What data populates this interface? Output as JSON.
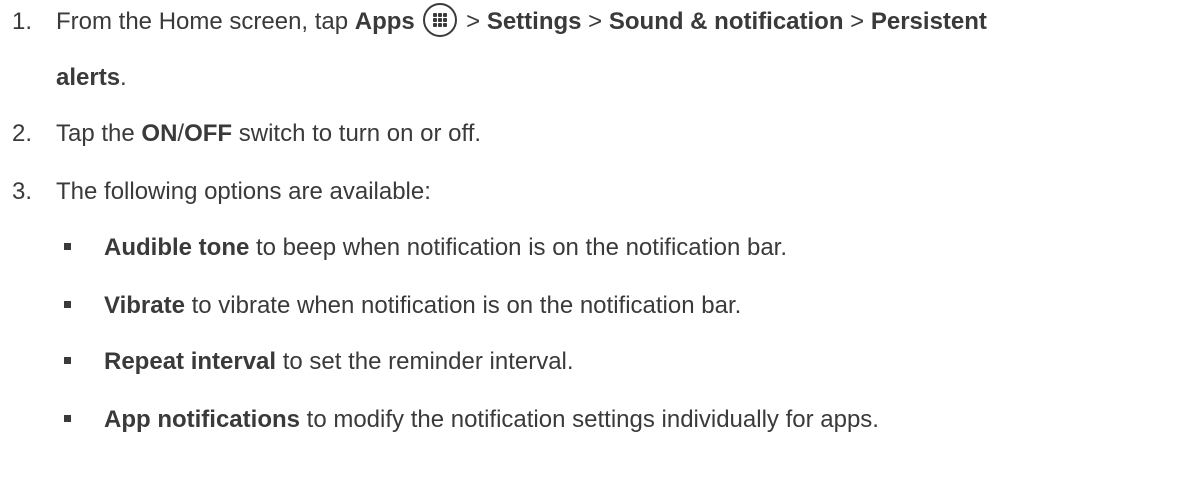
{
  "steps": [
    {
      "number": "1.",
      "text_before": "From the Home screen, tap ",
      "apps": "Apps",
      "sep1": " > ",
      "settings": "Settings",
      "sep2": " > ",
      "sound": "Sound & notification",
      "sep3": " > ",
      "persistent": "Persistent",
      "alerts": "alerts",
      "end": "."
    },
    {
      "number": "2.",
      "text_before": "Tap the ",
      "on": "ON",
      "slash": "/",
      "off": "OFF",
      "text_after": " switch to turn on or off."
    },
    {
      "number": "3.",
      "text": "The following options are available:"
    }
  ],
  "options": [
    {
      "title": "Audible tone",
      "desc": " to beep when notification is on the notification bar."
    },
    {
      "title": "Vibrate",
      "desc": " to vibrate when notification is on the notification bar."
    },
    {
      "title": "Repeat interval",
      "desc": " to set the reminder interval."
    },
    {
      "title": "App notifications",
      "desc": " to modify the notification settings individually for apps."
    }
  ],
  "icons": {
    "apps_icon": "apps-grid-icon"
  }
}
